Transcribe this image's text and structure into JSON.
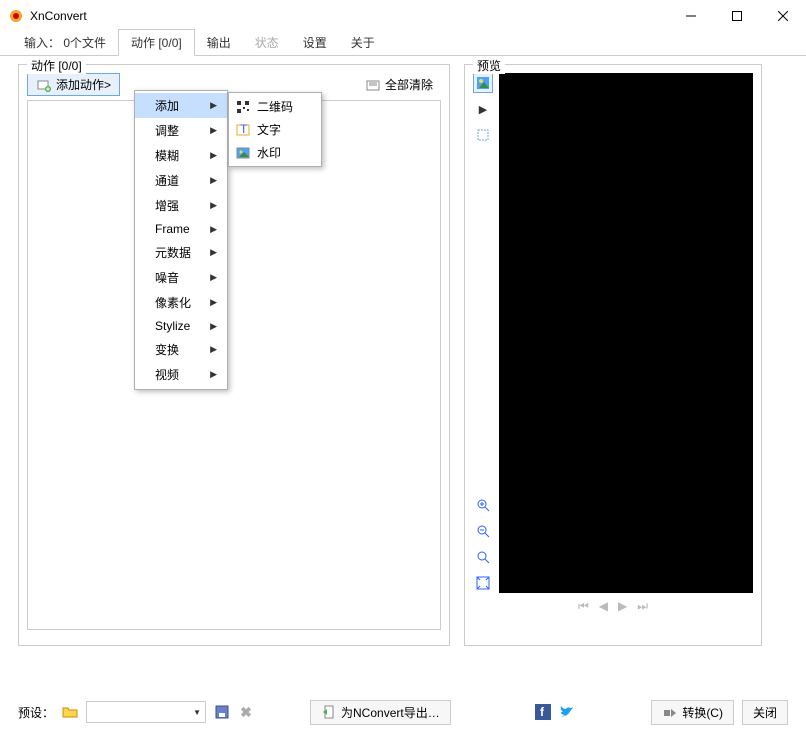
{
  "window": {
    "title": "XnConvert"
  },
  "tabs": {
    "input": "输入： 0个文件",
    "actions": "动作 [0/0]",
    "output": "输出",
    "status": "状态",
    "settings": "设置",
    "about": "关于"
  },
  "actions_panel": {
    "legend": "动作 [0/0]",
    "add_action": "添加动作>",
    "clear_all": "全部清除"
  },
  "menu1": {
    "add": "添加",
    "adjust": "调整",
    "blur": "模糊",
    "channel": "通道",
    "enhance": "增强",
    "frame": "Frame",
    "metadata": "元数据",
    "noise": "噪音",
    "pixelate": "像素化",
    "stylize": "Stylize",
    "transform": "变换",
    "video": "视频"
  },
  "menu2": {
    "qrcode": "二维码",
    "text": "文字",
    "watermark": "水印"
  },
  "preview": {
    "legend": "预览"
  },
  "bottom": {
    "preset": "预设：",
    "export": "为NConvert导出…",
    "convert": "转换(C)",
    "close": "关闭"
  }
}
